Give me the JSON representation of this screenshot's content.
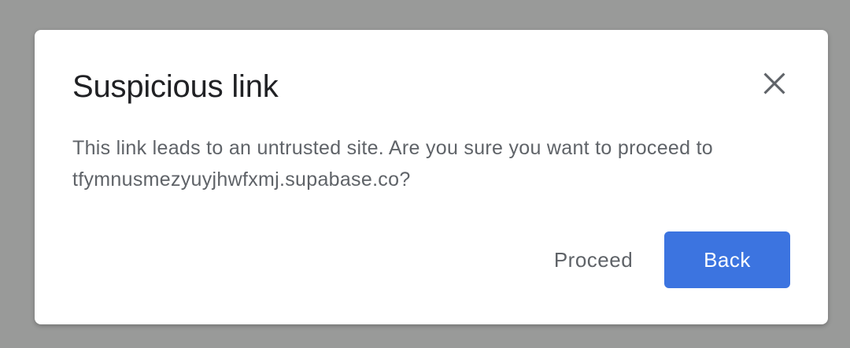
{
  "dialog": {
    "title": "Suspicious link",
    "message": "This link leads to an untrusted site. Are you sure you want to proceed to tfymnusmezyuyjhwfxmj.supabase.co?",
    "close_icon": "close-icon",
    "actions": {
      "proceed_label": "Proceed",
      "back_label": "Back"
    }
  },
  "colors": {
    "backdrop": "#999a99",
    "dialog_bg": "#ffffff",
    "title_text": "#202124",
    "body_text": "#5f6368",
    "primary_button": "#3c74e0",
    "primary_button_text": "#ffffff"
  }
}
